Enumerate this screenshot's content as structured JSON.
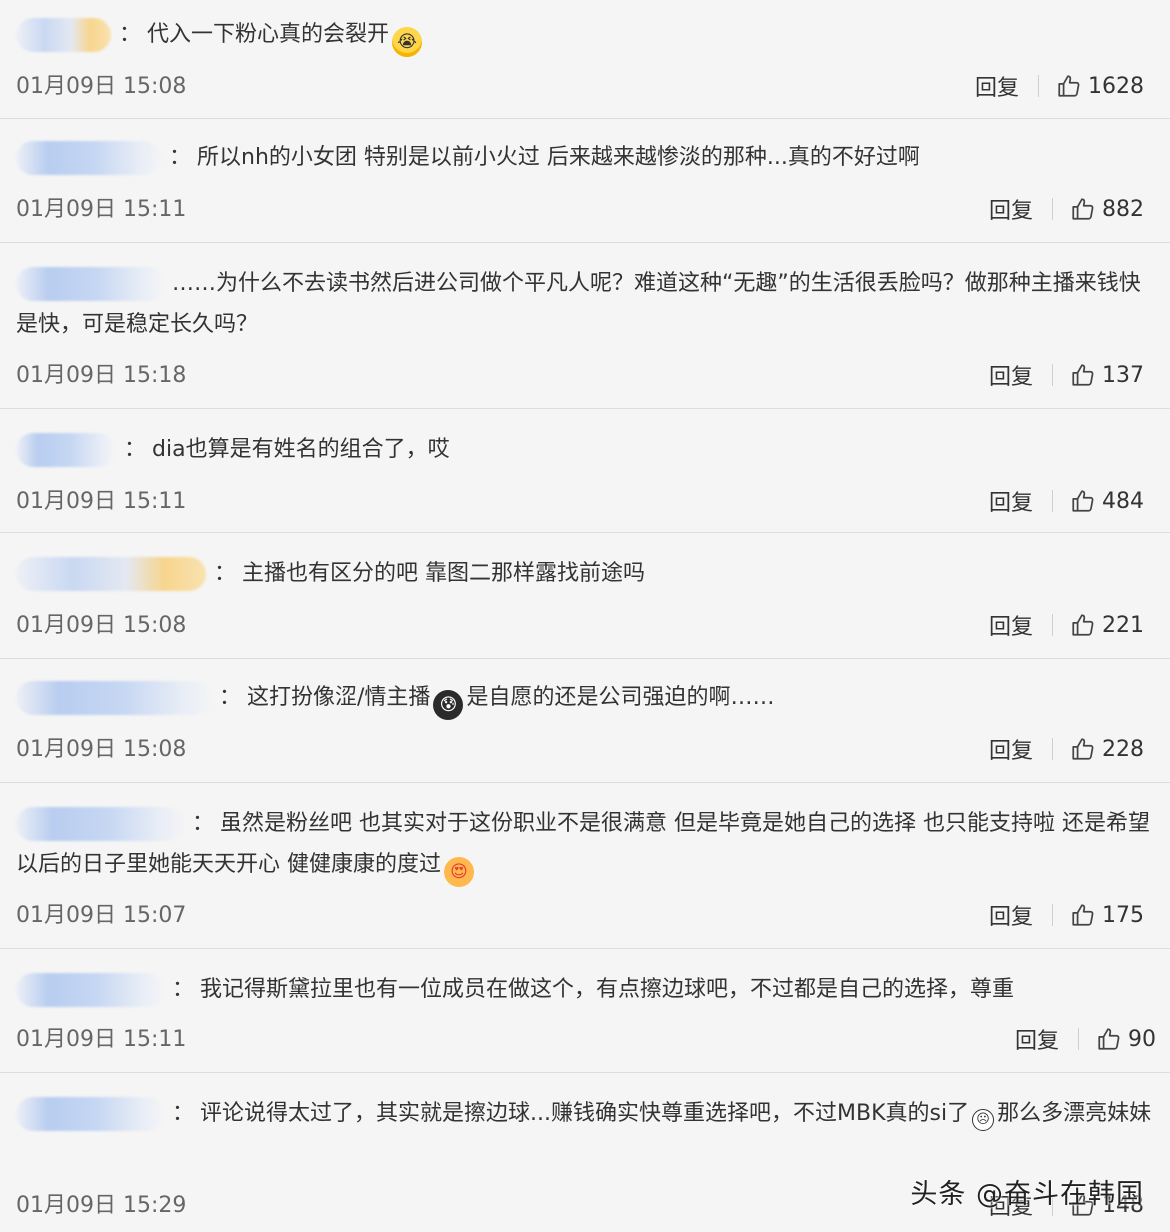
{
  "comments": [
    {
      "text_before_emoji": "代入一下粉心真的会裂开",
      "emoji": "loudly-crying-face",
      "timestamp": "01月09日 15:08",
      "reply_label": "回复",
      "likes": "1628"
    },
    {
      "text": "所以nh的小女团 特别是以前小火过 后来越来越惨淡的那种...真的不好过啊",
      "timestamp": "01月09日 15:11",
      "reply_label": "回复",
      "likes": "882"
    },
    {
      "text": "……为什么不去读书然后进公司做个平凡人呢？难道这种“无趣”的生活很丢脸吗？做那种主播来钱快是快，可是稳定长久吗？",
      "timestamp": "01月09日 15:18",
      "reply_label": "回复",
      "likes": "137"
    },
    {
      "text": "dia也算是有姓名的组合了，哎",
      "timestamp": "01月09日 15:11",
      "reply_label": "回复",
      "likes": "484"
    },
    {
      "text": "主播也有区分的吧 靠图二那样露找前途吗",
      "timestamp": "01月09日 15:08",
      "reply_label": "回复",
      "likes": "221"
    },
    {
      "text_before_emoji": "这打扮像涩/情主播",
      "emoji": "sweat-face",
      "text_after_emoji": "是自愿的还是公司强迫的啊……",
      "timestamp": "01月09日 15:08",
      "reply_label": "回复",
      "likes": "228"
    },
    {
      "text_before_emoji": "虽然是粉丝吧 也其实对于这份职业不是很满意 但是毕竟是她自己的选择 也只能支持啦 还是希望以后的日子里她能天天开心 健健康康的度过",
      "emoji": "heart-eyes-face",
      "timestamp": "01月09日 15:07",
      "reply_label": "回复",
      "likes": "175"
    },
    {
      "text": "我记得斯黛拉里也有一位成员在做这个，有点擦边球吧，不过都是自己的选择，尊重",
      "timestamp": "01月09日 15:11",
      "reply_label": "回复",
      "likes": "90"
    },
    {
      "text_before_emoji": "评论说得太过了，其实就是擦边球...赚钱确实快尊重选择吧，不过MBK真的si了",
      "emoji": "sad-face",
      "text_after_emoji": "那么多漂亮妹妹",
      "timestamp": "01月09日 15:29",
      "reply_label": "回复",
      "likes": "148"
    }
  ],
  "colon": "：",
  "watermark": "头条 @奋斗在韩国"
}
